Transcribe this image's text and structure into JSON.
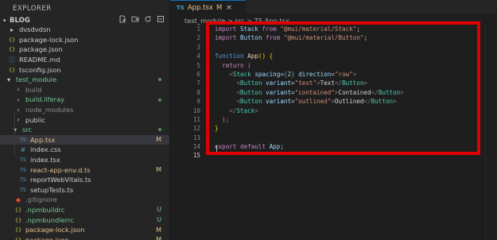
{
  "explorer": {
    "title": "EXPLORER",
    "project": "BLOG",
    "items": [
      {
        "label": "dvsdvdsn",
        "icon": "folder-icon",
        "mark": ""
      },
      {
        "label": "package-lock.json",
        "icon": "json-icon",
        "mark": ""
      },
      {
        "label": "package.json",
        "icon": "json-icon",
        "mark": ""
      },
      {
        "label": "README.md",
        "icon": "info-icon",
        "mark": ""
      },
      {
        "label": "tsconfig.json",
        "icon": "json-icon",
        "mark": ""
      },
      {
        "label": "test_module",
        "icon": "chevron-down-icon",
        "mark": "dot"
      },
      {
        "label": "build",
        "icon": "chevron-right-icon",
        "mark": ""
      },
      {
        "label": "build.liferay",
        "icon": "chevron-right-icon",
        "mark": "dot"
      },
      {
        "label": "node_modules",
        "icon": "chevron-right-icon",
        "mark": ""
      },
      {
        "label": "public",
        "icon": "chevron-right-icon",
        "mark": ""
      },
      {
        "label": "src",
        "icon": "chevron-down-icon",
        "mark": "dot"
      },
      {
        "label": "App.tsx",
        "icon": "ts-icon",
        "mark": "M"
      },
      {
        "label": "index.css",
        "icon": "css-icon",
        "mark": ""
      },
      {
        "label": "index.tsx",
        "icon": "ts-icon",
        "mark": ""
      },
      {
        "label": "react-app-env.d.ts",
        "icon": "ts-icon",
        "mark": "M"
      },
      {
        "label": "reportWebVitals.ts",
        "icon": "ts-icon",
        "mark": ""
      },
      {
        "label": "setupTests.ts",
        "icon": "ts-icon",
        "mark": ""
      },
      {
        "label": ".gitignore",
        "icon": "git-icon",
        "mark": ""
      },
      {
        "label": ".npmbuildrc",
        "icon": "json-icon",
        "mark": "U"
      },
      {
        "label": ".npmbundlerrc",
        "icon": "json-icon",
        "mark": "U"
      },
      {
        "label": "package-lock.json",
        "icon": "json-icon",
        "mark": "M"
      },
      {
        "label": "package.json",
        "icon": "json-icon",
        "mark": "M"
      }
    ]
  },
  "tab": {
    "prefix": "TS",
    "name": "App.tsx",
    "status": "M",
    "close": "×"
  },
  "breadcrumb": "test_module > src > TS App.tsx",
  "line_numbers": [
    "1",
    "2",
    "3",
    "4",
    "5",
    "6",
    "7",
    "8",
    "9",
    "10",
    "11",
    "12",
    "13",
    "14",
    "15"
  ],
  "code": {
    "l1": {
      "kw": "import",
      "name": "Stack",
      "from": "from",
      "str": "\"@mui/material/Stack\"",
      "end": ";"
    },
    "l2": {
      "kw": "import",
      "name": "Button",
      "from": "from",
      "str": "\"@mui/material/Button\"",
      "end": ";"
    },
    "l4": {
      "kw": "function",
      "name": "App",
      "rest": "() {"
    },
    "l5": {
      "kw": "return",
      "paren": "("
    },
    "l6": {
      "lt": "<",
      "tag": "Stack",
      "a1": "spacing",
      "eq1": "=",
      "v1o": "{",
      "v1": "2",
      "v1c": "}",
      "a2": "direction",
      "eq2": "=",
      "v2": "\"row\"",
      "gt": ">"
    },
    "l7": {
      "lt": "<",
      "tag": "Button",
      "attr": "variant",
      "eq": "=",
      "val": "\"text\"",
      "gt": ">",
      "text": "Text",
      "close": "</",
      "ctag": "Button",
      "cgt": ">"
    },
    "l8": {
      "lt": "<",
      "tag": "Button",
      "attr": "variant",
      "eq": "=",
      "val": "\"contained\"",
      "gt": ">",
      "text": "Contained",
      "close": "</",
      "ctag": "Button",
      "cgt": ">"
    },
    "l9": {
      "lt": "<",
      "tag": "Button",
      "attr": "variant",
      "eq": "=",
      "val": "\"outlined\"",
      "gt": ">",
      "text": "Outlined",
      "close": "</",
      "ctag": "Button",
      "cgt": ">"
    },
    "l10": {
      "lt": "</",
      "tag": "Stack",
      "gt": ">"
    },
    "l11": {
      "text": ");"
    },
    "l12": {
      "text": "}"
    },
    "l14": {
      "kw1": "export",
      "kw2": "default",
      "name": "App",
      "end": ";"
    }
  }
}
